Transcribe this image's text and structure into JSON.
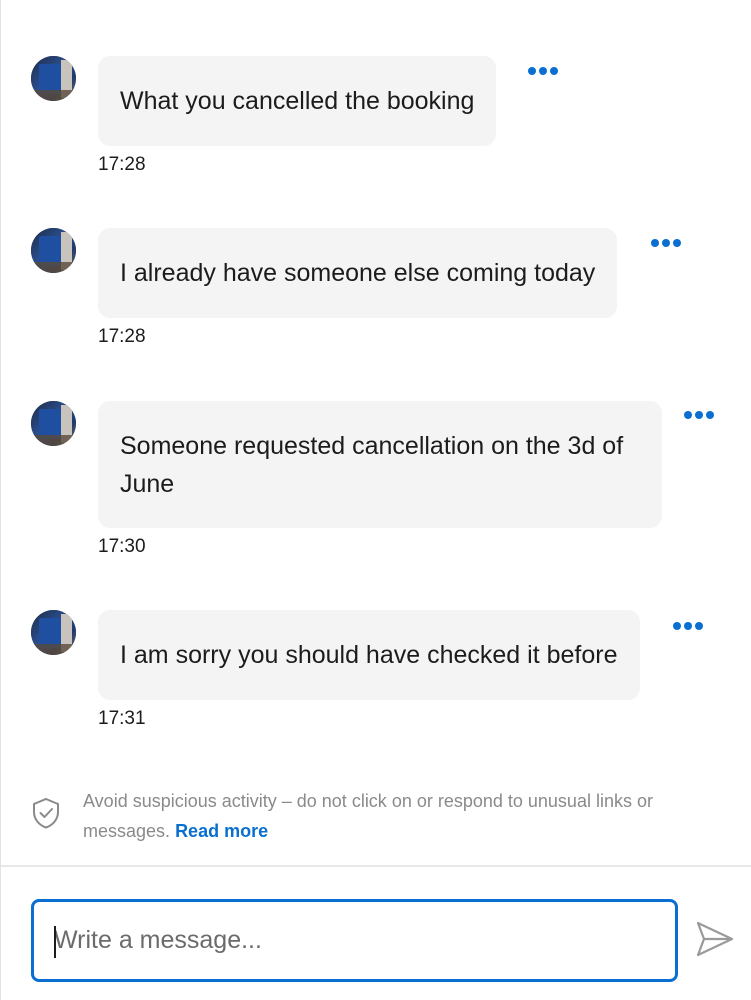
{
  "messages": [
    {
      "text": "What you cancelled the booking",
      "time": "17:28"
    },
    {
      "text": "I already have someone else coming today",
      "time": "17:28"
    },
    {
      "text": "Someone requested cancellation on the 3d of June",
      "time": "17:30"
    },
    {
      "text": "I am sorry you should have checked it before",
      "time": "17:31"
    }
  ],
  "notice": {
    "text": "Avoid suspicious activity – do not click on or respond to unusual links or messages.",
    "link": "Read more",
    "icon": "shield-check-icon"
  },
  "composer": {
    "placeholder": "Write a message...",
    "send_icon": "send-icon"
  },
  "colors": {
    "accent": "#0a6fd0",
    "bubble": "#f4f4f4",
    "muted_text": "#8a8a8a"
  }
}
